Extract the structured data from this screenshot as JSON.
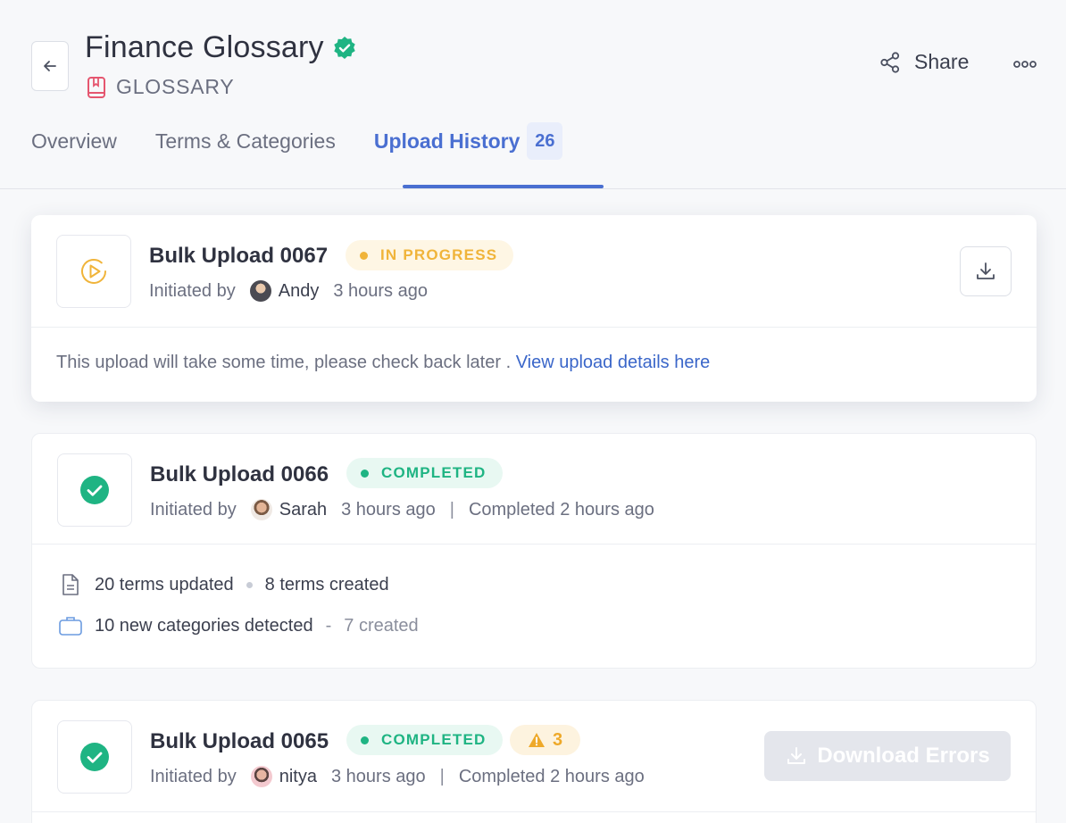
{
  "header": {
    "title": "Finance Glossary",
    "subtitle": "GLOSSARY",
    "share_label": "Share"
  },
  "tabs": [
    {
      "label": "Overview"
    },
    {
      "label": "Terms & Categories"
    },
    {
      "label": "Upload History",
      "count": "26",
      "active": true
    }
  ],
  "uploads": [
    {
      "title": "Bulk Upload 0067",
      "status": "IN PROGRESS",
      "initiated_label": "Initiated by",
      "user": "Andy",
      "time": "3 hours ago",
      "note": "This upload will take some time, please check back later .",
      "note_link": "View upload details here"
    },
    {
      "title": "Bulk Upload 0066",
      "status": "COMPLETED",
      "initiated_label": "Initiated by",
      "user": "Sarah",
      "time": "3 hours ago",
      "completed": "Completed 2 hours ago",
      "terms_updated": "20 terms updated",
      "terms_created": "8 terms created",
      "categories_detected": "10 new categories detected",
      "categories_created": "7 created"
    },
    {
      "title": "Bulk Upload 0065",
      "status": "COMPLETED",
      "warning_count": "3",
      "initiated_label": "Initiated by",
      "user": "nitya",
      "time": "3 hours ago",
      "completed": "Completed 2 hours ago",
      "download_errors_label": "Download Errors"
    }
  ],
  "colors": {
    "accent": "#4a6fd1",
    "verified": "#1fb483",
    "in_progress": "#f0b43a",
    "completed": "#1fb483",
    "link": "#3a66c9"
  }
}
